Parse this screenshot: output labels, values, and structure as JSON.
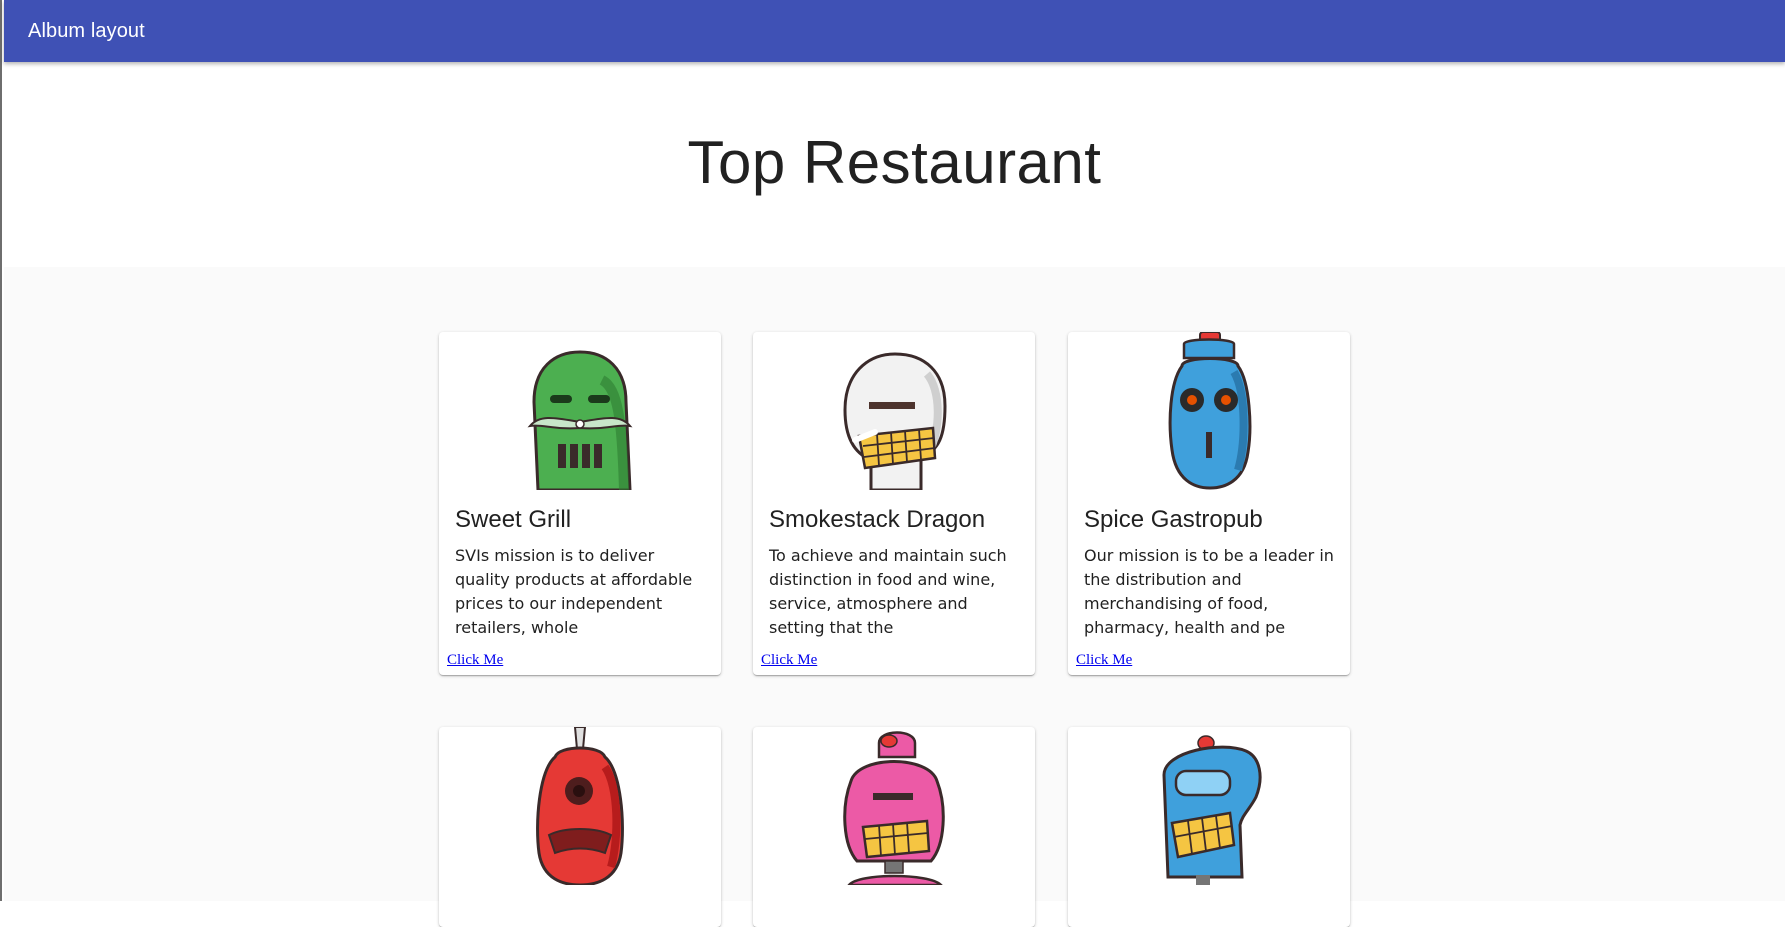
{
  "appbar": {
    "title": "Album layout"
  },
  "hero": {
    "title": "Top Restaurant"
  },
  "cards": [
    {
      "title": "Sweet Grill",
      "description": "SVIs mission is to deliver quality products at affordable prices to our independent retailers, whole",
      "action": "Click Me",
      "robot_color": "#4caf50"
    },
    {
      "title": "Smokestack Dragon",
      "description": "To achieve and maintain such distinction in food and wine, service, atmosphere and setting that the",
      "action": "Click Me",
      "robot_color": "#f2f2f2"
    },
    {
      "title": "Spice Gastropub",
      "description": "Our mission is to be a leader in the distribution and merchandising of food, pharmacy, health and pe",
      "action": "Click Me",
      "robot_color": "#3fa0dc"
    },
    {
      "robot_color": "#e53935"
    },
    {
      "robot_color": "#ec5aa6"
    },
    {
      "robot_color": "#3fa0dc"
    }
  ]
}
